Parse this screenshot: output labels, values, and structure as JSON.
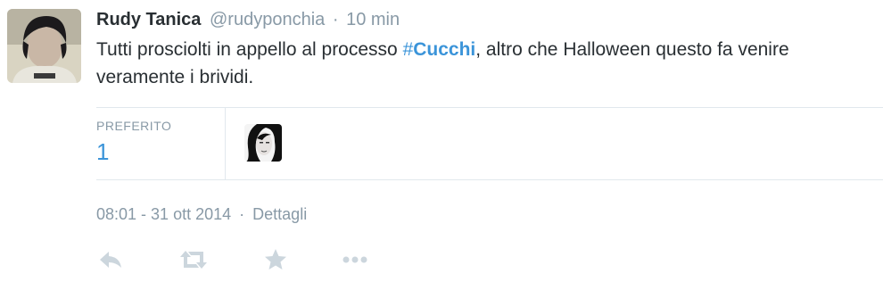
{
  "tweet": {
    "author_name": "Rudy Tanica",
    "screen_name": "@rudyponchia",
    "separator": "·",
    "relative_time": "10 min",
    "text_before": "Tutti prosciolti in appello al processo ",
    "hashtag_symbol": "#",
    "hashtag_word": "Cucchi",
    "text_after": ", altro che Halloween questo fa venire veramente i brividi."
  },
  "stats": {
    "favorites_label": "PREFERITO",
    "favorites_count": "1"
  },
  "meta": {
    "timestamp": "08:01 - 31 ott 2014",
    "separator": "·",
    "details_label": "Dettagli"
  },
  "actions": [
    {
      "icon": "reply-icon"
    },
    {
      "icon": "retweet-icon"
    },
    {
      "icon": "favorite-star-icon"
    },
    {
      "icon": "more-icon"
    }
  ],
  "colors": {
    "link": "#3b94d9",
    "muted": "#8899a6",
    "text": "#292f33",
    "divider": "#e1e8ed",
    "action_icon": "#ccd6dd"
  }
}
